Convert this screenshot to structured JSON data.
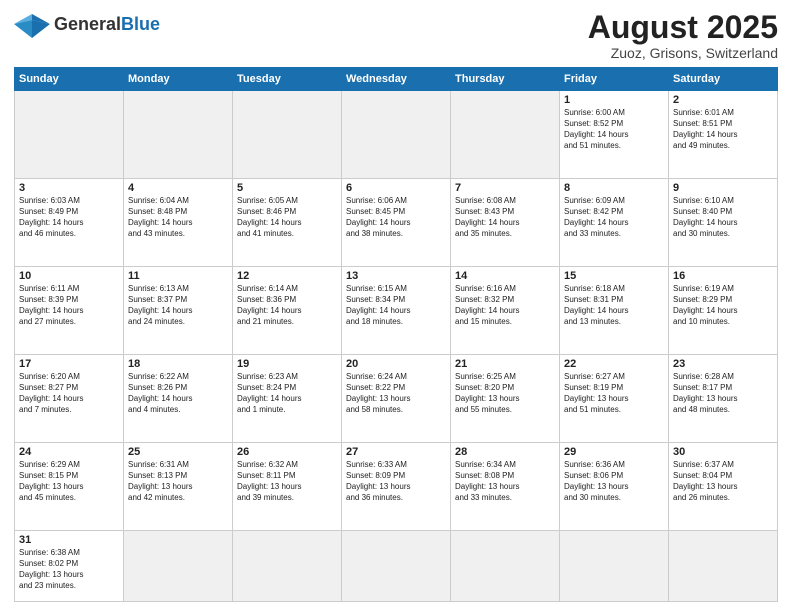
{
  "header": {
    "logo_general": "General",
    "logo_blue": "Blue",
    "title": "August 2025",
    "subtitle": "Zuoz, Grisons, Switzerland"
  },
  "days_of_week": [
    "Sunday",
    "Monday",
    "Tuesday",
    "Wednesday",
    "Thursday",
    "Friday",
    "Saturday"
  ],
  "weeks": [
    [
      {
        "num": "",
        "info": "",
        "empty": true
      },
      {
        "num": "",
        "info": "",
        "empty": true
      },
      {
        "num": "",
        "info": "",
        "empty": true
      },
      {
        "num": "",
        "info": "",
        "empty": true
      },
      {
        "num": "",
        "info": "",
        "empty": true
      },
      {
        "num": "1",
        "info": "Sunrise: 6:00 AM\nSunset: 8:52 PM\nDaylight: 14 hours\nand 51 minutes."
      },
      {
        "num": "2",
        "info": "Sunrise: 6:01 AM\nSunset: 8:51 PM\nDaylight: 14 hours\nand 49 minutes."
      }
    ],
    [
      {
        "num": "3",
        "info": "Sunrise: 6:03 AM\nSunset: 8:49 PM\nDaylight: 14 hours\nand 46 minutes."
      },
      {
        "num": "4",
        "info": "Sunrise: 6:04 AM\nSunset: 8:48 PM\nDaylight: 14 hours\nand 43 minutes."
      },
      {
        "num": "5",
        "info": "Sunrise: 6:05 AM\nSunset: 8:46 PM\nDaylight: 14 hours\nand 41 minutes."
      },
      {
        "num": "6",
        "info": "Sunrise: 6:06 AM\nSunset: 8:45 PM\nDaylight: 14 hours\nand 38 minutes."
      },
      {
        "num": "7",
        "info": "Sunrise: 6:08 AM\nSunset: 8:43 PM\nDaylight: 14 hours\nand 35 minutes."
      },
      {
        "num": "8",
        "info": "Sunrise: 6:09 AM\nSunset: 8:42 PM\nDaylight: 14 hours\nand 33 minutes."
      },
      {
        "num": "9",
        "info": "Sunrise: 6:10 AM\nSunset: 8:40 PM\nDaylight: 14 hours\nand 30 minutes."
      }
    ],
    [
      {
        "num": "10",
        "info": "Sunrise: 6:11 AM\nSunset: 8:39 PM\nDaylight: 14 hours\nand 27 minutes."
      },
      {
        "num": "11",
        "info": "Sunrise: 6:13 AM\nSunset: 8:37 PM\nDaylight: 14 hours\nand 24 minutes."
      },
      {
        "num": "12",
        "info": "Sunrise: 6:14 AM\nSunset: 8:36 PM\nDaylight: 14 hours\nand 21 minutes."
      },
      {
        "num": "13",
        "info": "Sunrise: 6:15 AM\nSunset: 8:34 PM\nDaylight: 14 hours\nand 18 minutes."
      },
      {
        "num": "14",
        "info": "Sunrise: 6:16 AM\nSunset: 8:32 PM\nDaylight: 14 hours\nand 15 minutes."
      },
      {
        "num": "15",
        "info": "Sunrise: 6:18 AM\nSunset: 8:31 PM\nDaylight: 14 hours\nand 13 minutes."
      },
      {
        "num": "16",
        "info": "Sunrise: 6:19 AM\nSunset: 8:29 PM\nDaylight: 14 hours\nand 10 minutes."
      }
    ],
    [
      {
        "num": "17",
        "info": "Sunrise: 6:20 AM\nSunset: 8:27 PM\nDaylight: 14 hours\nand 7 minutes."
      },
      {
        "num": "18",
        "info": "Sunrise: 6:22 AM\nSunset: 8:26 PM\nDaylight: 14 hours\nand 4 minutes."
      },
      {
        "num": "19",
        "info": "Sunrise: 6:23 AM\nSunset: 8:24 PM\nDaylight: 14 hours\nand 1 minute."
      },
      {
        "num": "20",
        "info": "Sunrise: 6:24 AM\nSunset: 8:22 PM\nDaylight: 13 hours\nand 58 minutes."
      },
      {
        "num": "21",
        "info": "Sunrise: 6:25 AM\nSunset: 8:20 PM\nDaylight: 13 hours\nand 55 minutes."
      },
      {
        "num": "22",
        "info": "Sunrise: 6:27 AM\nSunset: 8:19 PM\nDaylight: 13 hours\nand 51 minutes."
      },
      {
        "num": "23",
        "info": "Sunrise: 6:28 AM\nSunset: 8:17 PM\nDaylight: 13 hours\nand 48 minutes."
      }
    ],
    [
      {
        "num": "24",
        "info": "Sunrise: 6:29 AM\nSunset: 8:15 PM\nDaylight: 13 hours\nand 45 minutes."
      },
      {
        "num": "25",
        "info": "Sunrise: 6:31 AM\nSunset: 8:13 PM\nDaylight: 13 hours\nand 42 minutes."
      },
      {
        "num": "26",
        "info": "Sunrise: 6:32 AM\nSunset: 8:11 PM\nDaylight: 13 hours\nand 39 minutes."
      },
      {
        "num": "27",
        "info": "Sunrise: 6:33 AM\nSunset: 8:09 PM\nDaylight: 13 hours\nand 36 minutes."
      },
      {
        "num": "28",
        "info": "Sunrise: 6:34 AM\nSunset: 8:08 PM\nDaylight: 13 hours\nand 33 minutes."
      },
      {
        "num": "29",
        "info": "Sunrise: 6:36 AM\nSunset: 8:06 PM\nDaylight: 13 hours\nand 30 minutes."
      },
      {
        "num": "30",
        "info": "Sunrise: 6:37 AM\nSunset: 8:04 PM\nDaylight: 13 hours\nand 26 minutes."
      }
    ],
    [
      {
        "num": "31",
        "info": "Sunrise: 6:38 AM\nSunset: 8:02 PM\nDaylight: 13 hours\nand 23 minutes.",
        "last": true
      },
      {
        "num": "",
        "info": "",
        "empty": true,
        "last": true
      },
      {
        "num": "",
        "info": "",
        "empty": true,
        "last": true
      },
      {
        "num": "",
        "info": "",
        "empty": true,
        "last": true
      },
      {
        "num": "",
        "info": "",
        "empty": true,
        "last": true
      },
      {
        "num": "",
        "info": "",
        "empty": true,
        "last": true
      },
      {
        "num": "",
        "info": "",
        "empty": true,
        "last": true
      }
    ]
  ]
}
